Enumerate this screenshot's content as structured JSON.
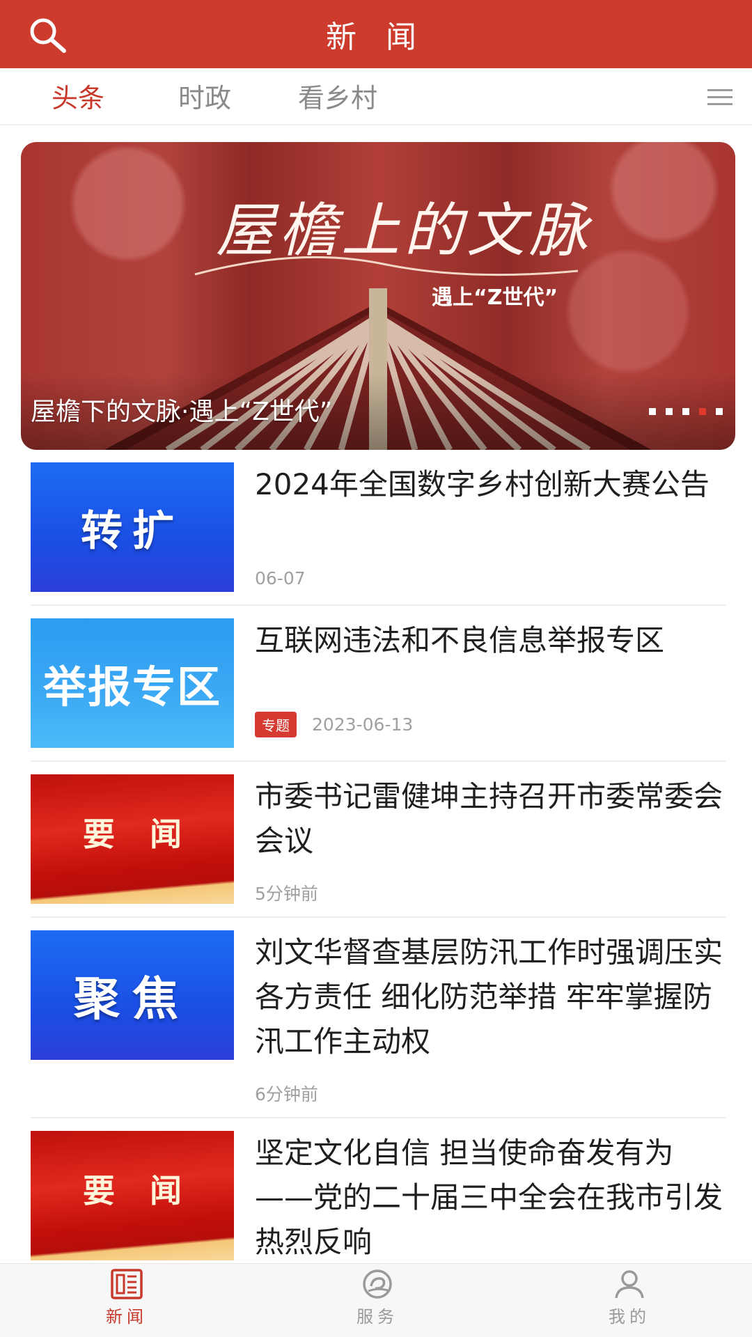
{
  "header": {
    "title": "新 闻",
    "search_icon": "search-icon",
    "background_color": "#cd3b2d"
  },
  "tabs": [
    {
      "label": "头条",
      "active": true
    },
    {
      "label": "时政",
      "active": false
    },
    {
      "label": "看乡村",
      "active": false
    }
  ],
  "tab_menu_icon": "menu-icon",
  "accent_color": "#c8392b",
  "banner": {
    "art_title": "屋檐上的文脉",
    "art_subtitle": "遇上“Z世代”",
    "caption": "屋檐下的文脉·遇上“Z世代”",
    "slide_count": 5,
    "active_slide": 4
  },
  "news": [
    {
      "thumb_text": "转扩",
      "thumb_style": "blue",
      "title": "2024年全国数字乡村创新大赛公告",
      "time": "06-07",
      "tag": ""
    },
    {
      "thumb_text": "举报专区",
      "thumb_style": "lightblue",
      "title": "互联网违法和不良信息举报专区",
      "time": "2023-06-13",
      "tag": "专题"
    },
    {
      "thumb_text": "要闻",
      "thumb_style": "red",
      "title": "市委书记雷健坤主持召开市委常委会会议",
      "time": "5分钟前",
      "tag": ""
    },
    {
      "thumb_text": "聚焦",
      "thumb_style": "blue",
      "title": "刘文华督查基层防汛工作时强调压实各方责任 细化防范举措 牢牢掌握防汛工作主动权",
      "time": "6分钟前",
      "tag": ""
    },
    {
      "thumb_text": "要闻",
      "thumb_style": "red",
      "title": "坚定文化自信 担当使命奋发有为——党的二十届三中全会在我市引发热烈反响",
      "time": "",
      "tag": ""
    }
  ],
  "bottom_nav": [
    {
      "label": "新闻",
      "icon": "newspaper-icon",
      "active": true
    },
    {
      "label": "服务",
      "icon": "service-icon",
      "active": false
    },
    {
      "label": "我的",
      "icon": "user-icon",
      "active": false
    }
  ]
}
